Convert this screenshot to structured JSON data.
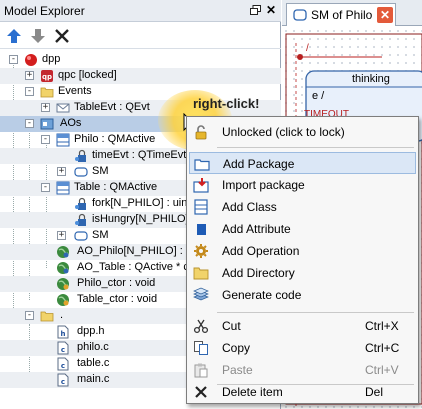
{
  "explorer": {
    "title": "Model Explorer",
    "close_glyph": "✕",
    "toolbar": [
      {
        "icon": "move-up-arrow-icon",
        "color": "#2a6fd0"
      },
      {
        "icon": "move-down-arrow-icon",
        "color": "#8a8a8a"
      },
      {
        "icon": "delete-x-icon",
        "color": "#222222"
      }
    ],
    "tree": [
      {
        "label": "dpp",
        "icon": "package-red-icon",
        "expander": "-"
      },
      {
        "label": "qpc [locked]",
        "icon": "qpc-package-icon",
        "expander": "+"
      },
      {
        "label": "Events",
        "icon": "folder-icon",
        "expander": "-"
      },
      {
        "label": "TableEvt : QEvt",
        "icon": "event-class-icon",
        "expander": "+"
      },
      {
        "label": "AOs",
        "icon": "package-blue-icon",
        "expander": "-"
      },
      {
        "label": "Philo : QMActive",
        "icon": "class-icon",
        "expander": "-"
      },
      {
        "label": "timeEvt : QTimeEvt",
        "icon": "attribute-icon",
        "expander": ""
      },
      {
        "label": "SM",
        "icon": "state-machine-icon",
        "expander": "+"
      },
      {
        "label": "Table : QMActive",
        "icon": "class-icon",
        "expander": "-"
      },
      {
        "label": "fork[N_PHILO] : uint",
        "icon": "attribute-icon",
        "expander": ""
      },
      {
        "label": "isHungry[N_PHILO]",
        "icon": "attribute-icon",
        "expander": ""
      },
      {
        "label": "SM",
        "icon": "state-machine-icon",
        "expander": "+"
      },
      {
        "label": "AO_Philo[N_PHILO] : Q",
        "icon": "global-attribute-icon",
        "expander": ""
      },
      {
        "label": "AO_Table : QActive * c",
        "icon": "global-attribute-icon",
        "expander": ""
      },
      {
        "label": "Philo_ctor : void",
        "icon": "operation-icon",
        "expander": ""
      },
      {
        "label": "Table_ctor : void",
        "icon": "operation-icon",
        "expander": ""
      },
      {
        "label": ".",
        "icon": "directory-icon",
        "expander": "-"
      },
      {
        "label": "dpp.h",
        "icon": "h-file-icon",
        "expander": ""
      },
      {
        "label": "philo.c",
        "icon": "c-file-icon",
        "expander": ""
      },
      {
        "label": "table.c",
        "icon": "c-file-icon",
        "expander": ""
      },
      {
        "label": "main.c",
        "icon": "c-file-icon",
        "expander": ""
      }
    ]
  },
  "diagram": {
    "tab_label": "SM of Philo",
    "tab_close_glyph": "✕",
    "state_name": "thinking",
    "entry_label": "e /",
    "transition_label": "TIMEOUT"
  },
  "callout": {
    "text": "right-click!"
  },
  "context_menu": {
    "items": [
      {
        "label": "Unlocked (click to lock)",
        "icon": "unlocked-padlock-icon",
        "shortcut": "",
        "state": "normal"
      },
      {
        "label": "Add Package",
        "icon": "add-package-icon",
        "shortcut": "",
        "state": "highlighted"
      },
      {
        "label": "Import package",
        "icon": "import-package-icon",
        "shortcut": "",
        "state": "normal"
      },
      {
        "label": "Add Class",
        "icon": "add-class-icon",
        "shortcut": "",
        "state": "normal"
      },
      {
        "label": "Add Attribute",
        "icon": "add-attribute-icon",
        "shortcut": "",
        "state": "normal"
      },
      {
        "label": "Add Operation",
        "icon": "add-operation-icon",
        "shortcut": "",
        "state": "normal"
      },
      {
        "label": "Add Directory",
        "icon": "add-directory-icon",
        "shortcut": "",
        "state": "normal"
      },
      {
        "label": "Generate code",
        "icon": "generate-code-icon",
        "shortcut": "",
        "state": "normal"
      },
      {
        "label": "Cut",
        "icon": "scissors-icon",
        "shortcut": "Ctrl+X",
        "state": "normal"
      },
      {
        "label": "Copy",
        "icon": "copy-icon",
        "shortcut": "Ctrl+C",
        "state": "normal"
      },
      {
        "label": "Paste",
        "icon": "paste-icon",
        "shortcut": "Ctrl+V",
        "state": "disabled"
      },
      {
        "label": "Delete item",
        "icon": "delete-x-icon",
        "shortcut": "Del",
        "state": "normal"
      }
    ]
  },
  "colors": {
    "selection": "#b9cde6",
    "menu_highlight": "#dbe7f6",
    "accent_red": "#e35a3a",
    "state_fill": "#e8f0fb"
  }
}
